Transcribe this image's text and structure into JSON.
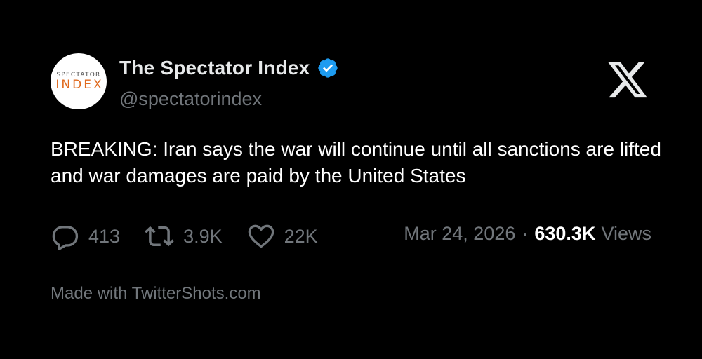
{
  "author": {
    "avatar_text_top": "SPECTATOR",
    "avatar_text_bottom": "INDEX",
    "display_name": "The Spectator Index",
    "handle": "@spectatorindex",
    "verified": true
  },
  "platform_icon": "x-logo-icon",
  "tweet": {
    "text": "BREAKING: Iran says the war will continue until all sanctions are lifted and war damages are paid by the United States"
  },
  "stats": {
    "replies": "413",
    "retweets": "3.9K",
    "likes": "22K"
  },
  "meta": {
    "date": "Mar 24, 2026",
    "separator": "·",
    "views_count": "630.3K",
    "views_label": "Views"
  },
  "footer": {
    "text": "Made with TwitterShots.com"
  },
  "colors": {
    "background": "#000000",
    "text_primary": "#e7e9ea",
    "text_secondary": "#71767b",
    "verified_blue": "#1d9bf0",
    "avatar_accent": "#e06a1e"
  }
}
